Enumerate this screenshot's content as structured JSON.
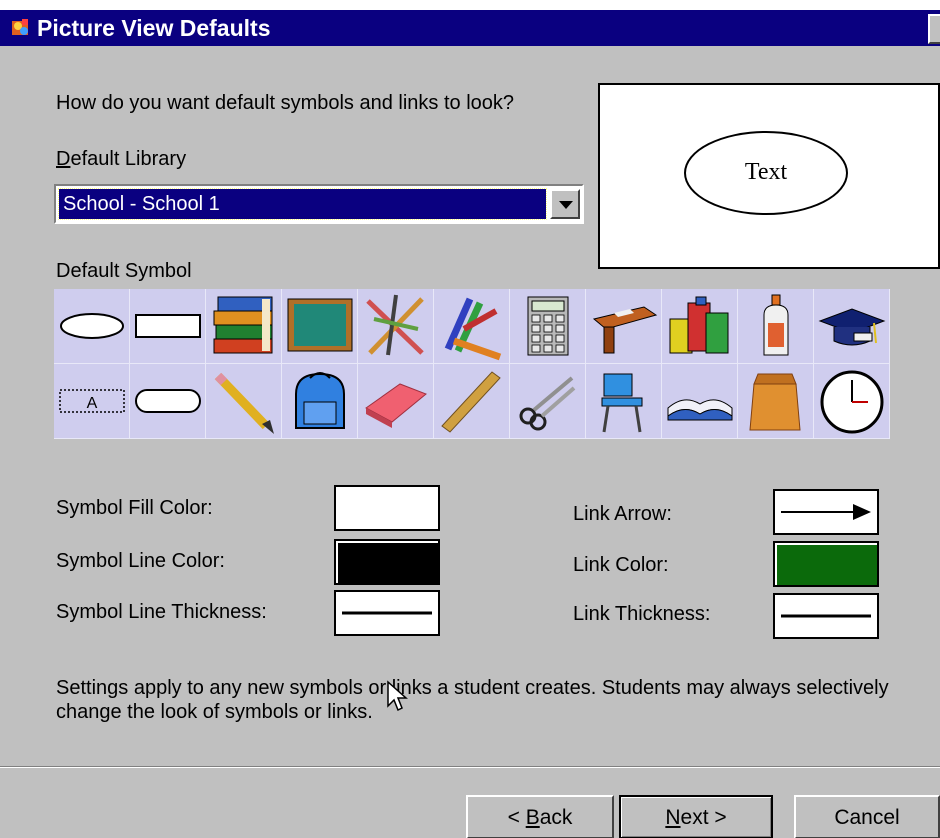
{
  "window": {
    "title": "Picture View Defaults"
  },
  "prompt": "How do you want default symbols and links to look?",
  "library": {
    "label": "Default Library",
    "selected": "School - School 1"
  },
  "preview": {
    "text": "Text"
  },
  "symbols": {
    "label": "Default Symbol",
    "row1": [
      "ellipse",
      "rectangle",
      "books",
      "chalkboard",
      "art-supplies",
      "crayons",
      "calculator",
      "desk",
      "paint-jars",
      "glue",
      "graduation-cap"
    ],
    "row2": [
      "text-box",
      "rounded-rectangle",
      "pencil",
      "backpack",
      "eraser",
      "ruler",
      "scissors",
      "student-chair",
      "open-book",
      "paper-bag",
      "clock"
    ],
    "row2_text_box_label": "A"
  },
  "properties": {
    "fill_label": "Symbol Fill Color:",
    "fill_color": "#ffffff",
    "line_color_label": "Symbol Line Color:",
    "line_color": "#000000",
    "line_thickness_label": "Symbol Line Thickness:",
    "link_arrow_label": "Link Arrow:",
    "link_color_label": "Link Color:",
    "link_color": "#0b6a0b",
    "link_thickness_label": "Link Thickness:"
  },
  "note": "Settings apply to any new symbols or links a student creates. Students may always selectively change the look of symbols or links.",
  "buttons": {
    "back": {
      "prefix": "< ",
      "accel": "B",
      "rest": "ack"
    },
    "next": {
      "accel": "N",
      "rest": "ext >"
    },
    "cancel": "Cancel"
  }
}
